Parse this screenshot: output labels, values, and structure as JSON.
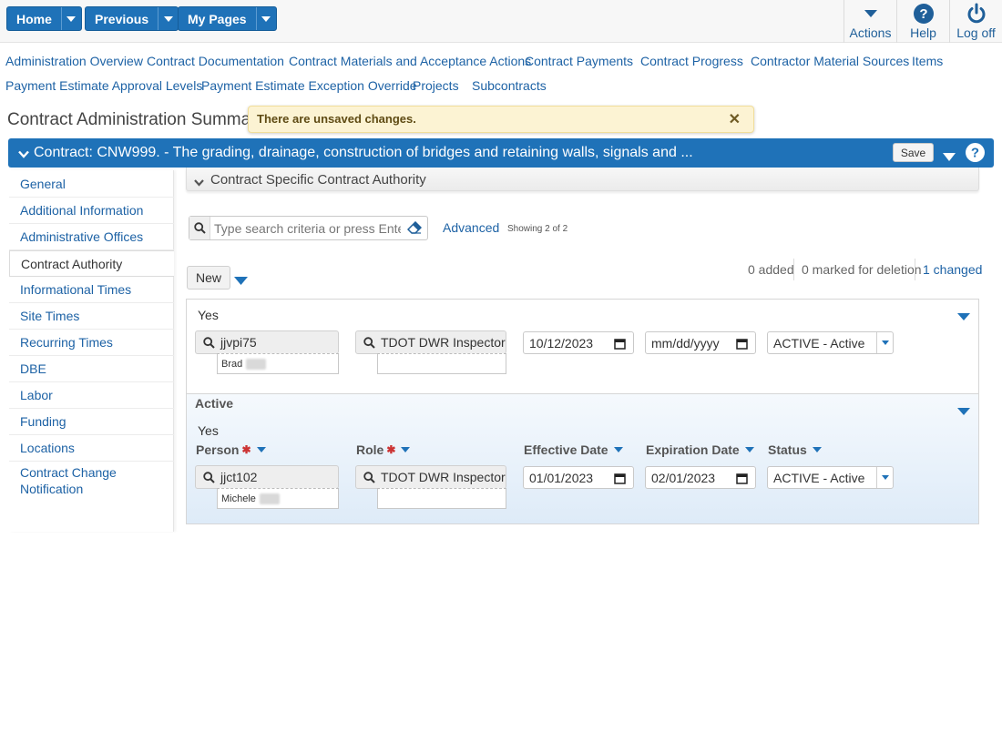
{
  "topnav": {
    "home": "Home",
    "previous": "Previous",
    "my_pages": "My Pages",
    "actions": "Actions",
    "help": "Help",
    "logoff": "Log off"
  },
  "links": [
    "Administration Overview",
    "Contract Documentation",
    "Contract Materials and Acceptance Actions",
    "Contract Payments",
    "Contract Progress",
    "Contractor Material Sources",
    "Items",
    "Payment Estimate Approval Levels",
    "Payment Estimate Exception Override",
    "Projects",
    "Subcontracts"
  ],
  "page_title": "Contract Administration Summary",
  "toast": {
    "message": "There are unsaved changes."
  },
  "contract_header": {
    "title": "Contract: CNW999. - The grading, drainage, construction of bridges and retaining walls, signals and ...",
    "save": "Save"
  },
  "sidebar": {
    "items": [
      "General",
      "Additional Information",
      "Administrative Offices",
      "Contract Authority",
      "Informational Times",
      "Site Times",
      "Recurring Times",
      "DBE",
      "Labor",
      "Funding",
      "Locations",
      "Contract Change Notification"
    ],
    "active": "Contract Authority"
  },
  "section": {
    "title": "Contract Specific Contract Authority"
  },
  "search": {
    "placeholder": "Type search criteria or press Enter",
    "advanced": "Advanced",
    "showing": "Showing 2 of 2"
  },
  "toolbar": {
    "new": "New",
    "added": "0 added",
    "marked": "0 marked for deletion",
    "changed": "1 changed"
  },
  "row1": {
    "active_value": "Yes",
    "person": "jjvpi75",
    "person_name": "Brad",
    "role": "TDOT DWR Inspector",
    "effective": "10/12/2023",
    "expiration": "mm/dd/yyyy",
    "status": "ACTIVE - Active"
  },
  "row2": {
    "active_label": "Active",
    "active_value": "Yes",
    "headers": {
      "person": "Person",
      "role": "Role",
      "effective": "Effective Date",
      "expiration": "Expiration Date",
      "status": "Status"
    },
    "person": "jjct102",
    "person_name": "Michele",
    "role": "TDOT DWR Inspector",
    "effective": "01/01/2023",
    "expiration": "02/01/2023",
    "status": "ACTIVE - Active"
  },
  "colors": {
    "primary": "#1f72b8",
    "link": "#1d62a5",
    "toast_bg": "#fcf3d3",
    "selected_row": "#deebf8"
  }
}
